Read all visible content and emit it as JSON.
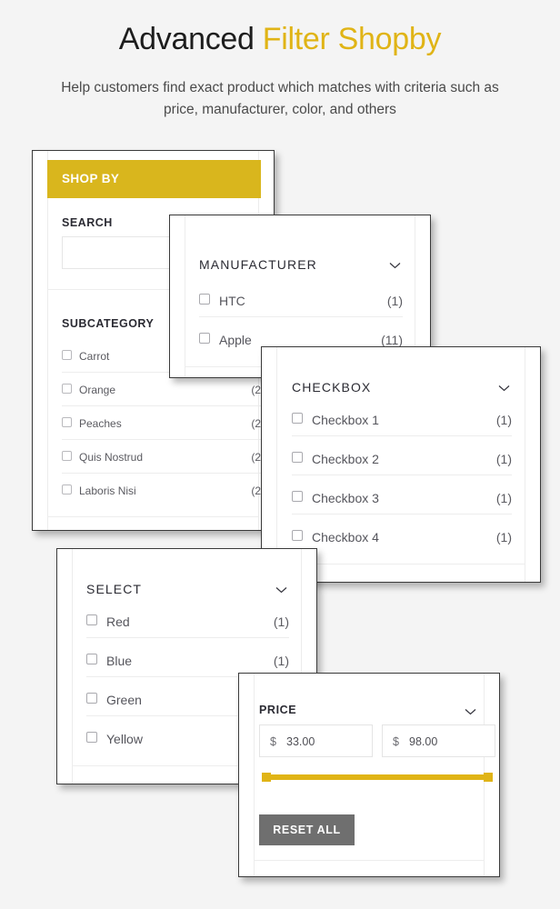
{
  "header": {
    "title_plain": "Advanced ",
    "title_accent": "Filter Shopby",
    "subtitle": "Help customers find exact product which matches with criteria such as price, manufacturer, color, and others"
  },
  "colors": {
    "accent_yellow": "#d9b61d",
    "slider_yellow": "#e0b416",
    "reset_gray": "#6f6f6f",
    "page_background": "#f4f4f4",
    "text_dark": "#2b2b33",
    "text_muted": "#5a5a60"
  },
  "shopby_panel": {
    "header_label": "SHOP BY",
    "search_label": "SEARCH",
    "search_value": "",
    "search_placeholder": "",
    "subcategory_label": "SUBCATEGORY",
    "subcategory_items": [
      {
        "label": "Carrot",
        "count": "(2"
      },
      {
        "label": "Orange",
        "count": "(2"
      },
      {
        "label": "Peaches",
        "count": "(2"
      },
      {
        "label": "Quis Nostrud",
        "count": "(2"
      },
      {
        "label": "Laboris Nisi",
        "count": "(2"
      }
    ]
  },
  "manufacturer_panel": {
    "title": "MANUFACTURER",
    "chevron": "chevron-down-icon",
    "items": [
      {
        "label": "HTC",
        "count": "(1)"
      },
      {
        "label": "Apple",
        "count": "(11)"
      }
    ]
  },
  "checkbox_panel": {
    "title": "CHECKBOX",
    "chevron": "chevron-down-icon",
    "items": [
      {
        "label": "Checkbox 1",
        "count": "(1)"
      },
      {
        "label": "Checkbox 2",
        "count": "(1)"
      },
      {
        "label": "Checkbox 3",
        "count": "(1)"
      },
      {
        "label": "Checkbox 4",
        "count": "(1)"
      }
    ]
  },
  "select_panel": {
    "title": "SELECT",
    "chevron": "chevron-down-icon",
    "items": [
      {
        "label": "Red",
        "count": "(1)"
      },
      {
        "label": "Blue",
        "count": "(1)"
      },
      {
        "label": "Green",
        "count": ""
      },
      {
        "label": "Yellow",
        "count": ""
      }
    ]
  },
  "price_panel": {
    "title": "PRICE",
    "chevron": "chevron-down-icon",
    "currency": "$",
    "min_value": "33.00",
    "max_value": "98.00",
    "reset_label": "RESET ALL"
  }
}
